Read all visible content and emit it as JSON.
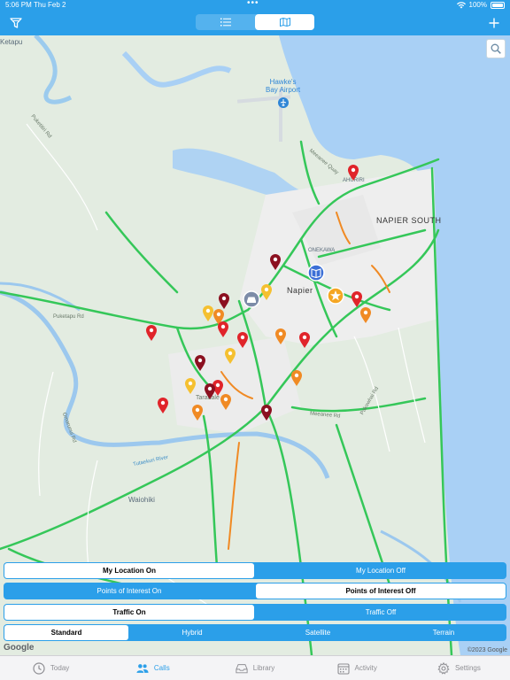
{
  "status": {
    "time": "5:06 PM",
    "date": "Thu Feb 2",
    "battery": "100%"
  },
  "toolbar": {
    "view_modes": [
      {
        "icon": "list-icon",
        "active": false
      },
      {
        "icon": "map-icon",
        "active": true
      }
    ]
  },
  "map": {
    "labels": {
      "town_top_left": "Ketapu",
      "airport": "Hawke's\nBay Airport",
      "suburb_ahuriri": "AHURIRI",
      "suburb_napier_south": "NAPIER SOUTH",
      "suburb_onekawa": "ONEKAWA",
      "city_napier": "Napier",
      "waiohiki": "Waiohiki",
      "river": "Tutaekuri River",
      "road_meeanee": "Meeanee Rd",
      "road_puketapu": "Puketapu Rd",
      "road_taradale": "Taradale",
      "road_quay": "Meeanee Quay",
      "road_pakowhai": "Pakowhai Rd",
      "road_puketitiri": "Puketitiri Rd",
      "road_omarunui": "Omarunui Rd"
    },
    "google": "Google",
    "copyright": "©2023 Google"
  },
  "controls": {
    "location": {
      "options": [
        "My Location On",
        "My Location Off"
      ],
      "selected": 0
    },
    "poi": {
      "options": [
        "Points of Interest On",
        "Points of Interest Off"
      ],
      "selected": 1
    },
    "traffic": {
      "options": [
        "Traffic On",
        "Traffic Off"
      ],
      "selected": 0
    },
    "map_type": {
      "options": [
        "Standard",
        "Hybrid",
        "Satellite",
        "Terrain"
      ],
      "selected": 0
    }
  },
  "tabs": [
    {
      "label": "Today",
      "icon": "clock-icon",
      "active": false
    },
    {
      "label": "Calls",
      "icon": "people-icon",
      "active": true
    },
    {
      "label": "Library",
      "icon": "tray-icon",
      "active": false
    },
    {
      "label": "Activity",
      "icon": "calendar-icon",
      "active": false
    },
    {
      "label": "Settings",
      "icon": "gear-icon",
      "active": false
    }
  ],
  "colors": {
    "accent": "#2b9fe9",
    "pin_red": "#e0242a",
    "pin_darkred": "#8b1020",
    "pin_orange": "#f0a020",
    "pin_yellow": "#f5c030"
  }
}
